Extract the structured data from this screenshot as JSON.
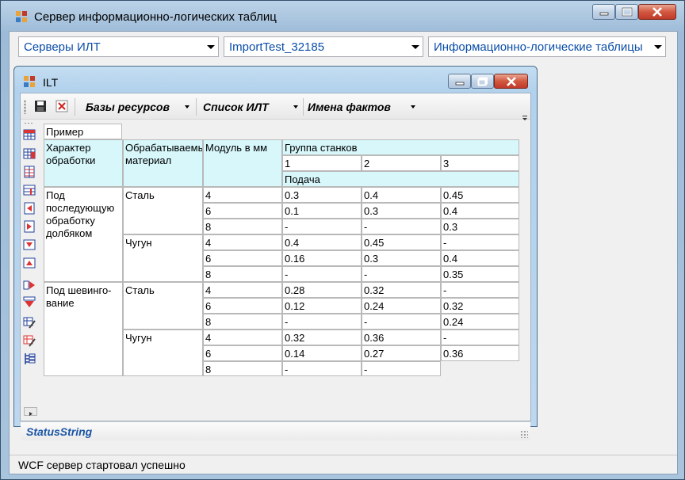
{
  "outer_window": {
    "title": "Сервер информационно-логических таблиц",
    "combo_servers": "Серверы ИЛТ",
    "combo_import": "ImportTest_32185",
    "combo_tables": "Информационно-логические таблицы",
    "status": "WCF сервер стартовал успешно"
  },
  "inner_window": {
    "title": "ILT",
    "toolbar": {
      "resources": "Базы ресурсов",
      "ilt_list": "Список ИЛТ",
      "fact_names": "Имена фактов"
    },
    "status": "StatusString"
  },
  "table": {
    "caption": "Пример",
    "headers": {
      "processing": "Характер обработки",
      "material": "Обрабатываемый материал",
      "module": "Модуль в мм",
      "machine_group": "Группа станков",
      "group_1": "1",
      "group_2": "2",
      "group_3": "3",
      "feed": "Подача"
    },
    "blocks": [
      {
        "processing": "Под последующую обработку долбяком",
        "materials": [
          {
            "name": "Сталь",
            "rows": [
              [
                "4",
                "0.3",
                "0.4",
                "0.45"
              ],
              [
                "6",
                "0.1",
                "0.3",
                "0.4"
              ],
              [
                "8",
                "-",
                "-",
                "0.3"
              ]
            ]
          },
          {
            "name": "Чугун",
            "rows": [
              [
                "4",
                "0.4",
                "0.45",
                "-"
              ],
              [
                "6",
                "0.16",
                "0.3",
                "0.4"
              ],
              [
                "8",
                "-",
                "-",
                "0.35"
              ]
            ]
          }
        ]
      },
      {
        "processing": "Под шевинго-вание",
        "materials": [
          {
            "name": "Сталь",
            "rows": [
              [
                "4",
                "0.28",
                "0.32",
                "-"
              ],
              [
                "6",
                "0.12",
                "0.24",
                "0.32"
              ],
              [
                "8",
                "-",
                "-",
                "0.24"
              ]
            ]
          },
          {
            "name": "Чугун",
            "rows": [
              [
                "4",
                "0.32",
                "0.36",
                "-"
              ],
              [
                "6",
                "0.14",
                "0.27",
                "0.36"
              ],
              [
                "8",
                "-",
                "-",
                null
              ]
            ]
          }
        ]
      }
    ]
  }
}
